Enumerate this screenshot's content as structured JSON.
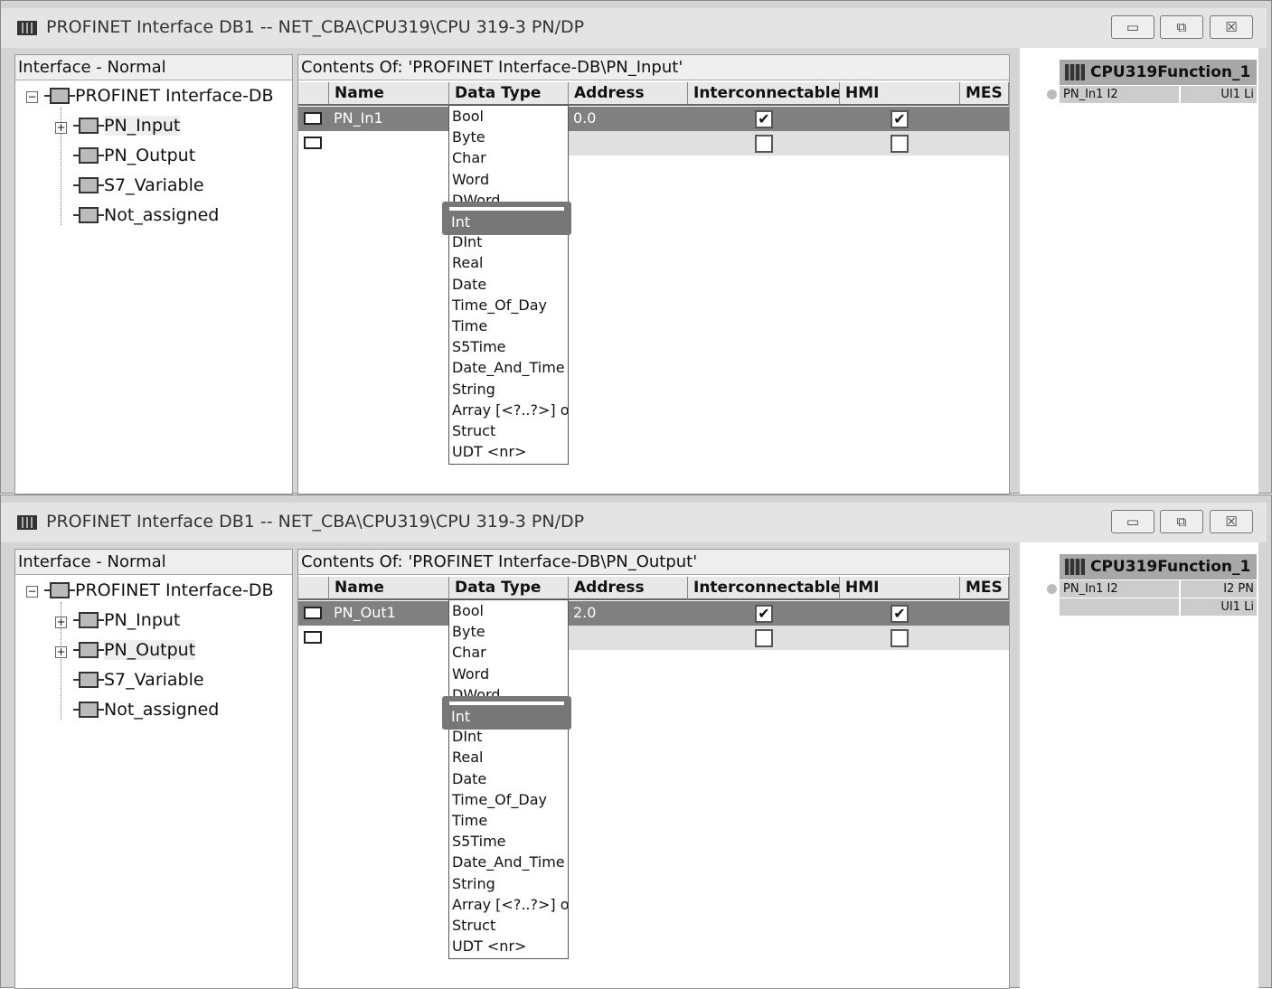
{
  "windows": [
    {
      "title": "PROFINET Interface DB1 -- NET_CBA\\CPU319\\CPU 319-3 PN/DP",
      "buttons": {
        "minimize": "▭",
        "restore": "⧉",
        "close": "☒"
      },
      "left_header": "Interface - Normal",
      "tree": {
        "root": "PROFINET Interface-DB",
        "items": [
          "PN_Input",
          "PN_Output",
          "S7_Variable",
          "Not_assigned"
        ],
        "highlighted": "PN_Input"
      },
      "contents_header": "Contents Of: 'PROFINET Interface-DB\\PN_Input'",
      "columns": [
        "Name",
        "Data Type",
        "Address",
        "Interconnectable",
        "HMI",
        "MES"
      ],
      "row": {
        "name": "PN_In1",
        "data_type": "Int",
        "address": "0.0",
        "interconnectable": true,
        "hmi": true
      },
      "dropdown": {
        "options": [
          "Bool",
          "Byte",
          "Char",
          "Word",
          "DWord",
          "Int",
          "DInt",
          "Real",
          "Date",
          "Time_Of_Day",
          "Time",
          "S5Time",
          "Date_And_Time",
          "String",
          "Array [<?..?>] o",
          "Struct",
          "UDT <nr>"
        ],
        "selected": "Int"
      },
      "function_block": {
        "title": "CPU319Function_1",
        "rows": [
          {
            "left": "PN_In1  I2",
            "right": "UI1  Li"
          }
        ]
      }
    },
    {
      "title": "PROFINET Interface DB1 -- NET_CBA\\CPU319\\CPU 319-3 PN/DP",
      "buttons": {
        "minimize": "▭",
        "restore": "⧉",
        "close": "☒"
      },
      "left_header": "Interface - Normal",
      "tree": {
        "root": "PROFINET Interface-DB",
        "items": [
          "PN_Input",
          "PN_Output",
          "S7_Variable",
          "Not_assigned"
        ],
        "highlighted": "PN_Output"
      },
      "contents_header": "Contents Of: 'PROFINET Interface-DB\\PN_Output'",
      "columns": [
        "Name",
        "Data Type",
        "Address",
        "Interconnectable",
        "HMI",
        "MES"
      ],
      "row": {
        "name": "PN_Out1",
        "data_type": "Int",
        "address": "2.0",
        "interconnectable": true,
        "hmi": true
      },
      "dropdown": {
        "options": [
          "Bool",
          "Byte",
          "Char",
          "Word",
          "DWord",
          "Int",
          "DInt",
          "Real",
          "Date",
          "Time_Of_Day",
          "Time",
          "S5Time",
          "Date_And_Time",
          "String",
          "Array [<?..?>] o",
          "Struct",
          "UDT <nr>"
        ],
        "selected": "Int"
      },
      "function_block": {
        "title": "CPU319Function_1",
        "rows": [
          {
            "left": "PN_In1  I2",
            "right": "I2  PN"
          },
          {
            "left": "",
            "right": "UI1  Li"
          }
        ]
      }
    }
  ]
}
